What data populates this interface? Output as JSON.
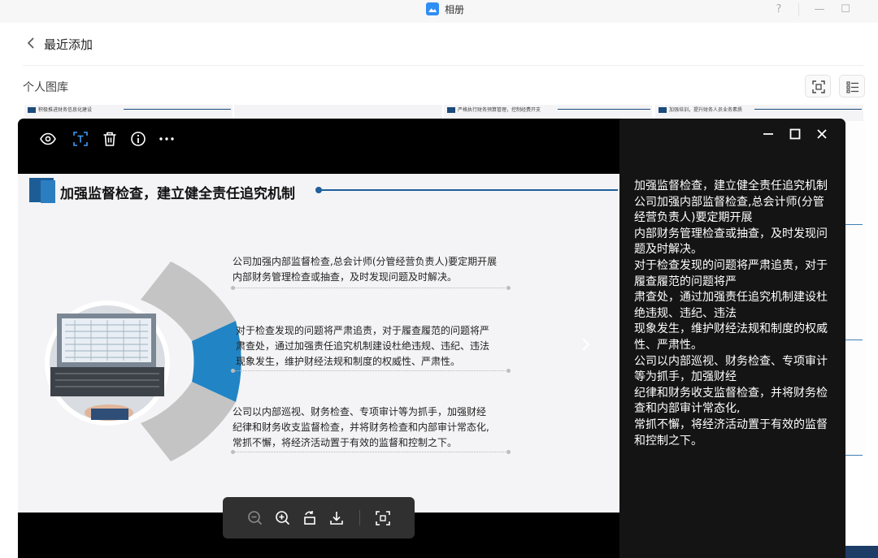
{
  "window": {
    "title": "相册",
    "help_label": "?",
    "minimize_label": "—",
    "maximize_label": "☐"
  },
  "header": {
    "back_icon": "chevron-left-icon",
    "title": "最近添加"
  },
  "library": {
    "title": "个人图库",
    "tools": [
      "scan-text-icon",
      "list-view-icon"
    ],
    "thumbnails": [
      {
        "caption": "积极推进财务信息化建设"
      },
      {
        "caption": "严格执行财务预算管理，控制经费开支"
      },
      {
        "caption": "加强培训，提升财务人员业务素质"
      }
    ]
  },
  "viewer": {
    "toolbar": [
      "eye-icon",
      "text-recognition-icon",
      "trash-icon",
      "info-icon",
      "more-icon"
    ],
    "window_controls": [
      "minimize-icon",
      "maximize-icon",
      "close-icon"
    ],
    "slide": {
      "title": "加强监督检查，建立健全责任追究机制",
      "paragraphs": [
        [
          "公司加强内部监督检查,总会计师(分管经营负责人)要定期开展",
          "内部财务管理检查或抽查，及时发现问题及时解决。"
        ],
        [
          "对于检查发现的问题将严肃追责，对于履查履范的问题将严",
          "肃查处，通过加强责任追究机制建设杜绝违规、违纪、违法",
          "现象发生，维护财经法规和制度的权威性、严肃性。"
        ],
        [
          "公司以内部巡视、财务检查、专项审计等为抓手，加强财经",
          "纪律和财务收支监督检查，并将财务检查和内部审计常态化,",
          "常抓不懈，将经济活动置于有效的监督和控制之下。"
        ]
      ],
      "accent_color": "#2185c5"
    },
    "ocr_lines": [
      "加强监督检查，建立健全责任追究机制",
      "公司加强内部监督检查,总会计师(分管经营负责人)要定期开展",
      "内部财务管理检查或抽查，及时发现问题及时解决。",
      "对于检查发现的问题将严肃追责，对于履查履范的问题将严",
      "肃查处，通过加强责任追究机制建设杜绝违规、违纪、违法",
      "现象发生，维护财经法规和制度的权威性、严肃性。",
      "公司以内部巡视、财务检查、专项审计等为抓手，加强财经",
      "纪律和财务收支监督检查，并将财务检查和内部审计常态化,",
      "常抓不懈，将经济活动置于有效的监督和控制之下。"
    ],
    "zoom_bar": [
      "zoom-out-icon",
      "zoom-in-icon",
      "rotate-icon",
      "download-icon",
      "fit-screen-icon"
    ]
  }
}
